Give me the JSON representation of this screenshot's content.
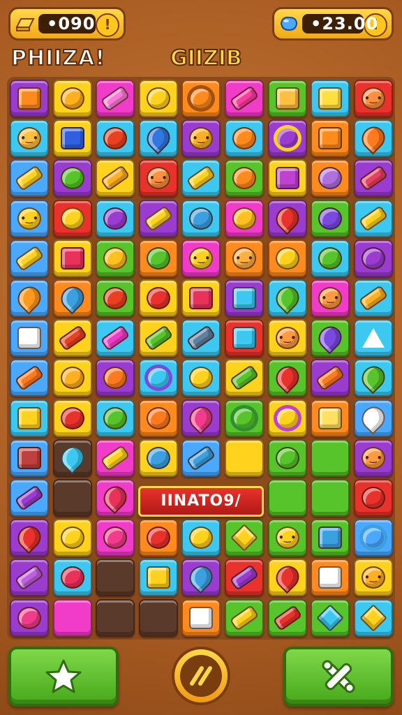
{
  "hud": {
    "coins": "•090",
    "gems": "•23.00",
    "info_label": "!"
  },
  "titles": {
    "left": "PHIIZA!",
    "center": "GIIZIB"
  },
  "banner": {
    "text": "IINATO9/"
  },
  "colors": {
    "blue": "#4aa8ff",
    "yellow": "#ffd21e",
    "magenta": "#f03cc8",
    "orange": "#ff8a1e",
    "green": "#56c42a",
    "cyan": "#3cc8f0",
    "red": "#e8322b",
    "purple": "#9a3cd0",
    "dark": "#5a3a2a"
  },
  "board": {
    "rows": [
      [
        [
          "purple",
          "sq",
          "#ff8a1e"
        ],
        [
          "yellow",
          "round",
          "#ffb020"
        ],
        [
          "magenta",
          "bar",
          "#ff7ad8"
        ],
        [
          "yellow",
          "round",
          "#ffd21e"
        ],
        [
          "orange",
          "ring",
          "#a05010"
        ],
        [
          "magenta",
          "bar",
          "#ff3ca0"
        ],
        [
          "green",
          "sq",
          "#ffc040"
        ],
        [
          "cyan",
          "sq",
          "#ffe040"
        ],
        [
          "red",
          "face",
          "#ff9040"
        ]
      ],
      [
        [
          "cyan",
          "face",
          "#ffc040"
        ],
        [
          "yellow",
          "sq",
          "#3060e0"
        ],
        [
          "cyan",
          "round",
          "#e84020"
        ],
        [
          "cyan",
          "drop",
          "#3078e0"
        ],
        [
          "purple",
          "face",
          "#ffb020"
        ],
        [
          "cyan",
          "round",
          "#ff8a1e"
        ],
        [
          "purple",
          "ring",
          "#ffd21e"
        ],
        [
          "orange",
          "sq",
          "#ff8a1e"
        ],
        [
          "cyan",
          "drop",
          "#ff7a1e"
        ]
      ],
      [
        [
          "blue",
          "bar",
          "#ffd21e"
        ],
        [
          "purple",
          "round",
          "#56c42a"
        ],
        [
          "yellow",
          "bar",
          "#ffb020"
        ],
        [
          "red",
          "face",
          "#ff9040"
        ],
        [
          "cyan",
          "bar",
          "#ffd21e"
        ],
        [
          "green",
          "round",
          "#ff8a1e"
        ],
        [
          "yellow",
          "sq",
          "#c040d0"
        ],
        [
          "orange",
          "round",
          "#b070e0"
        ],
        [
          "purple",
          "bar",
          "#e84060"
        ]
      ],
      [
        [
          "blue",
          "face",
          "#ffd21e"
        ],
        [
          "red",
          "round",
          "#ffd21e"
        ],
        [
          "cyan",
          "round",
          "#9a3cd0"
        ],
        [
          "purple",
          "bar",
          "#ffd21e"
        ],
        [
          "cyan",
          "round",
          "#3ca0e0"
        ],
        [
          "magenta",
          "round",
          "#ffc020"
        ],
        [
          "purple",
          "drop",
          "#e8322b"
        ],
        [
          "green",
          "round",
          "#7a4ae0"
        ],
        [
          "cyan",
          "bar",
          "#ffd21e"
        ]
      ],
      [
        [
          "blue",
          "bar",
          "#ffd21e"
        ],
        [
          "yellow",
          "sq",
          "#e8325a"
        ],
        [
          "green",
          "round",
          "#ffc020"
        ],
        [
          "orange",
          "round",
          "#56c42a"
        ],
        [
          "magenta",
          "face",
          "#ffd21e"
        ],
        [
          "orange",
          "face",
          "#ffb040"
        ],
        [
          "orange",
          "round",
          "#ffd21e"
        ],
        [
          "cyan",
          "round",
          "#56c42a"
        ],
        [
          "purple",
          "round",
          "#9a3cd0"
        ]
      ],
      [
        [
          "blue",
          "drop",
          "#ff9a1e"
        ],
        [
          "orange",
          "drop",
          "#3ca0e0"
        ],
        [
          "green",
          "round",
          "#e84020"
        ],
        [
          "yellow",
          "round",
          "#e8322b"
        ],
        [
          "yellow",
          "sq",
          "#e8325a"
        ],
        [
          "purple",
          "sq",
          "#3cc8f0"
        ],
        [
          "cyan",
          "drop",
          "#56c42a"
        ],
        [
          "magenta",
          "face",
          "#ff9a40"
        ],
        [
          "cyan",
          "bar",
          "#ffb020"
        ]
      ],
      [
        [
          "blue",
          "sq",
          "#ffffff"
        ],
        [
          "yellow",
          "bar",
          "#e84020"
        ],
        [
          "cyan",
          "bar",
          "#f03cc8"
        ],
        [
          "yellow",
          "bar",
          "#56c42a"
        ],
        [
          "cyan",
          "bar",
          "#6080a0"
        ],
        [
          "red",
          "sq",
          "#3cc8f0"
        ],
        [
          "yellow",
          "face",
          "#ff9a40"
        ],
        [
          "green",
          "drop",
          "#7a4ae0"
        ],
        [
          "cyan",
          "tri",
          "#ffffff"
        ]
      ],
      [
        [
          "blue",
          "bar",
          "#ff7a1e"
        ],
        [
          "yellow",
          "round",
          "#ffb020"
        ],
        [
          "purple",
          "round",
          "#ff7a1e"
        ],
        [
          "cyan",
          "ring",
          "#7a4ae0"
        ],
        [
          "cyan",
          "round",
          "#ffd21e"
        ],
        [
          "yellow",
          "bar",
          "#56c42a"
        ],
        [
          "green",
          "drop",
          "#e8322b"
        ],
        [
          "purple",
          "bar",
          "#ff7a1e"
        ],
        [
          "cyan",
          "drop",
          "#56c42a"
        ]
      ],
      [
        [
          "cyan",
          "sq",
          "#ffd21e"
        ],
        [
          "yellow",
          "round",
          "#e8322b"
        ],
        [
          "cyan",
          "round",
          "#56c42a"
        ],
        [
          "orange",
          "round",
          "#ff7a1e"
        ],
        [
          "purple",
          "drop",
          "#f03c8a"
        ],
        [
          "green",
          "ring",
          "#2f8e2f"
        ],
        [
          "yellow",
          "ring",
          "#c040d0"
        ],
        [
          "orange",
          "sq",
          "#ffe060"
        ],
        [
          "blue",
          "drop",
          "#ffffff"
        ]
      ],
      [
        [
          "blue",
          "sq",
          "#c04040"
        ],
        [
          "dark",
          "drop",
          "#3cc8f0"
        ],
        [
          "magenta",
          "bar",
          "#ffd21e"
        ],
        [
          "yellow",
          "round",
          "#3ca0e0"
        ],
        [
          "blue",
          "bar",
          "#3ca0e0"
        ],
        [
          "yellow",
          "none",
          ""
        ],
        [
          "green",
          "round",
          "#56c42a"
        ],
        [
          "green",
          "none",
          ""
        ],
        [
          "purple",
          "face",
          "#ff9a40"
        ]
      ],
      [
        [
          "blue",
          "bar",
          "#9a3cd0"
        ],
        [
          "dark",
          "none",
          ""
        ],
        [
          "magenta",
          "drop",
          "#e8325a"
        ],
        [
          "none",
          "none",
          ""
        ],
        [
          "none",
          "none",
          ""
        ],
        [
          "none",
          "none",
          ""
        ],
        [
          "green",
          "none",
          ""
        ],
        [
          "green",
          "none",
          ""
        ],
        [
          "red",
          "round",
          "#e8322b"
        ]
      ],
      [
        [
          "purple",
          "drop",
          "#e8322b"
        ],
        [
          "yellow",
          "round",
          "#ffd21e"
        ],
        [
          "magenta",
          "round",
          "#f03c8a"
        ],
        [
          "orange",
          "round",
          "#e8322b"
        ],
        [
          "cyan",
          "round",
          "#ffd21e"
        ],
        [
          "green",
          "dia",
          "#ffd21e"
        ],
        [
          "green",
          "face",
          "#ffd21e"
        ],
        [
          "green",
          "sq",
          "#3ca0e0"
        ],
        [
          "blue",
          "ring",
          "#3ca0e0"
        ]
      ],
      [
        [
          "purple",
          "bar",
          "#c060e0"
        ],
        [
          "cyan",
          "round",
          "#e8325a"
        ],
        [
          "dark",
          "none",
          ""
        ],
        [
          "cyan",
          "sq",
          "#ffd21e"
        ],
        [
          "purple",
          "drop",
          "#3ca0e0"
        ],
        [
          "red",
          "bar",
          "#9a3cd0"
        ],
        [
          "yellow",
          "drop",
          "#e8322b"
        ],
        [
          "orange",
          "sq",
          "#ffffff"
        ],
        [
          "yellow",
          "face",
          "#ffb020"
        ]
      ],
      [
        [
          "purple",
          "round",
          "#f03c8a"
        ],
        [
          "magenta",
          "none",
          ""
        ],
        [
          "dark",
          "none",
          ""
        ],
        [
          "dark",
          "none",
          ""
        ],
        [
          "orange",
          "sq",
          "#ffffff"
        ],
        [
          "green",
          "bar",
          "#ffd21e"
        ],
        [
          "green",
          "bar",
          "#e8322b"
        ],
        [
          "green",
          "dia",
          "#3cc8f0"
        ],
        [
          "cyan",
          "dia",
          "#ffd21e"
        ]
      ]
    ]
  }
}
